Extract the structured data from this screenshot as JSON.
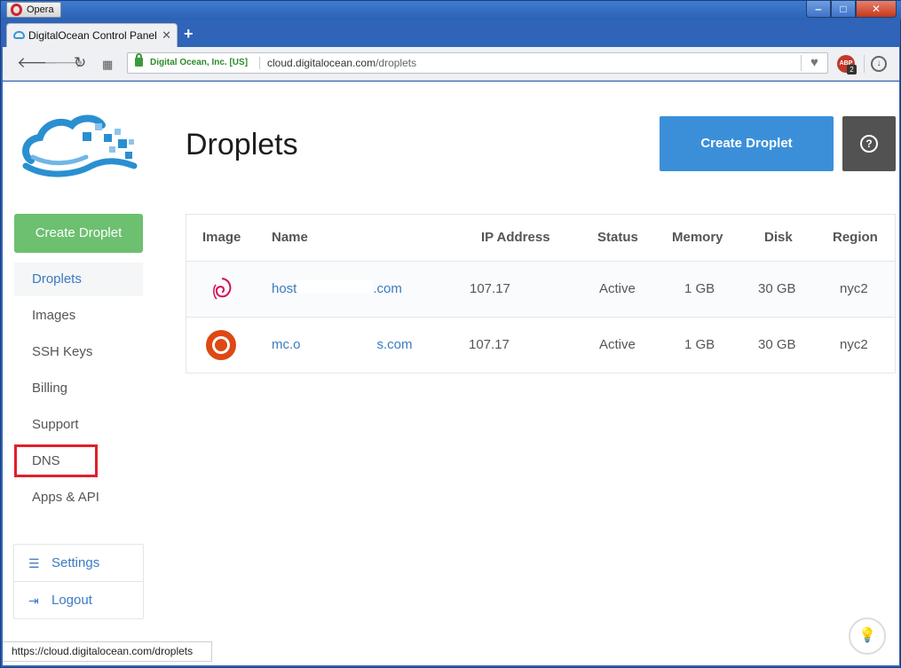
{
  "browser": {
    "menu_label": "Opera",
    "tab_title": "DigitalOcean Control Panel",
    "tab_close": "✕",
    "new_tab": "+",
    "ev_label": "Digital Ocean, Inc. [US]",
    "url_host": "cloud.digitalocean.com",
    "url_path": "/droplets",
    "abp_label": "ABP",
    "abp_count": "2",
    "status_url": "https://cloud.digitalocean.com/droplets"
  },
  "sidebar": {
    "create_label": "Create Droplet",
    "items": [
      {
        "label": "Droplets",
        "active": true
      },
      {
        "label": "Images"
      },
      {
        "label": "SSH Keys"
      },
      {
        "label": "Billing"
      },
      {
        "label": "Support"
      },
      {
        "label": "DNS"
      },
      {
        "label": "Apps & API"
      }
    ],
    "settings_label": "Settings",
    "logout_label": "Logout"
  },
  "main": {
    "title": "Droplets",
    "create_button": "Create Droplet",
    "help_icon": "?"
  },
  "table": {
    "headers": [
      "Image",
      "Name",
      "IP Address",
      "Status",
      "Memory",
      "Disk",
      "Region"
    ],
    "rows": [
      {
        "image": "debian",
        "name_start": "host",
        "name_end": ".com",
        "ip": "107.17",
        "status": "Active",
        "memory": "1 GB",
        "disk": "30 GB",
        "region": "nyc2"
      },
      {
        "image": "ubuntu",
        "name_start": "mc.o",
        "name_end": "s.com",
        "ip": "107.17",
        "status": "Active",
        "memory": "1 GB",
        "disk": "30 GB",
        "region": "nyc2"
      }
    ]
  },
  "colors": {
    "accent_blue": "#3b8fd9",
    "green": "#6cc070",
    "highlight_red": "#e0202a"
  }
}
